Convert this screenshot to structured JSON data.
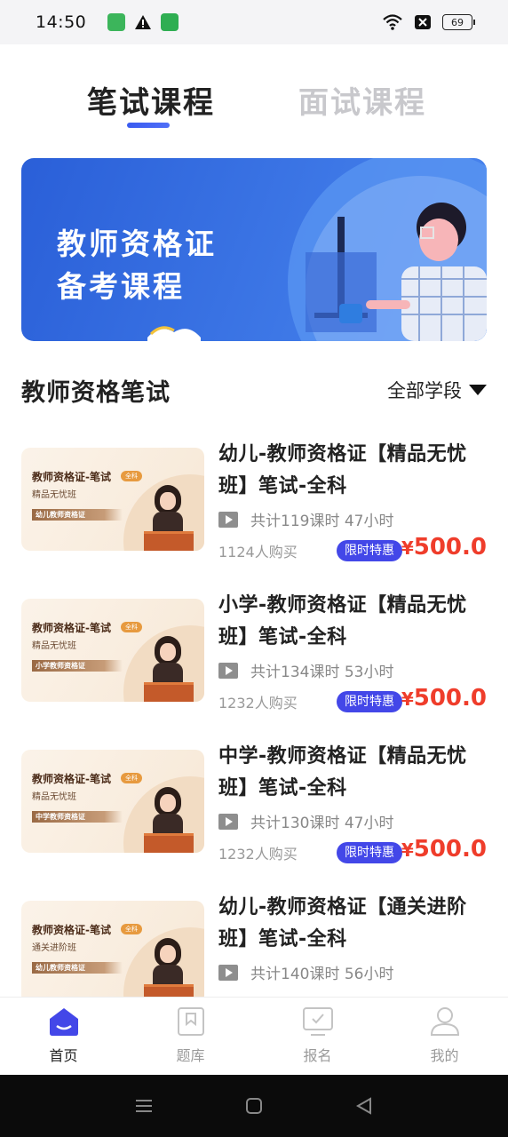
{
  "status_bar": {
    "time": "14:50",
    "battery": "69"
  },
  "tabs": [
    {
      "label": "笔试课程",
      "active": true
    },
    {
      "label": "面试课程",
      "active": false
    }
  ],
  "banner": {
    "line1": "教师资格证",
    "line2": "备考课程"
  },
  "section": {
    "title": "教师资格笔试",
    "filter_label": "全部学段"
  },
  "courses": [
    {
      "title": "幼儿-教师资格证【精品无忧班】笔试-全科",
      "lessons": "共计119课时 47小时",
      "buyers": "1124人购买",
      "badge": "限时特惠",
      "currency": "¥",
      "price": "500.0",
      "thumb": {
        "title": "教师资格证-笔试",
        "tag": "全科",
        "subtitle": "精品无忧班",
        "band": "幼儿教师资格证"
      }
    },
    {
      "title": "小学-教师资格证【精品无忧班】笔试-全科",
      "lessons": "共计134课时 53小时",
      "buyers": "1232人购买",
      "badge": "限时特惠",
      "currency": "¥",
      "price": "500.0",
      "thumb": {
        "title": "教师资格证-笔试",
        "tag": "全科",
        "subtitle": "精品无忧班",
        "band": "小学教师资格证"
      }
    },
    {
      "title": "中学-教师资格证【精品无忧班】笔试-全科",
      "lessons": "共计130课时 47小时",
      "buyers": "1232人购买",
      "badge": "限时特惠",
      "currency": "¥",
      "price": "500.0",
      "thumb": {
        "title": "教师资格证-笔试",
        "tag": "全科",
        "subtitle": "精品无忧班",
        "band": "中学教师资格证"
      }
    },
    {
      "title": "幼儿-教师资格证【通关进阶班】笔试-全科",
      "lessons": "共计140课时 56小时",
      "buyers": "",
      "badge": "",
      "currency": "",
      "price": "",
      "thumb": {
        "title": "教师资格证-笔试",
        "tag": "全科",
        "subtitle": "通关进阶班",
        "band": "幼儿教师资格证"
      }
    }
  ],
  "bottom_nav": [
    {
      "label": "首页",
      "icon": "home-icon",
      "active": true
    },
    {
      "label": "题库",
      "icon": "question-bank-icon",
      "active": false
    },
    {
      "label": "报名",
      "icon": "register-icon",
      "active": false
    },
    {
      "label": "我的",
      "icon": "profile-icon",
      "active": false
    }
  ],
  "colors": {
    "accent": "#4347e8",
    "price": "#ef3d2b",
    "banner": "#2a5fd8"
  }
}
